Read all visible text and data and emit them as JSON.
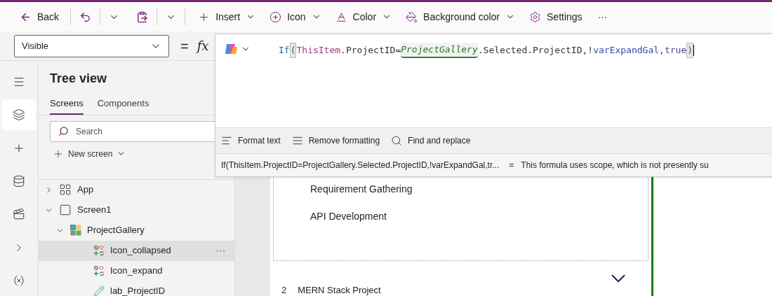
{
  "toolbar": {
    "back": "Back",
    "items": [
      {
        "label": "Insert"
      },
      {
        "label": "Icon"
      },
      {
        "label": "Color"
      },
      {
        "label": "Background color"
      }
    ],
    "settings": "Settings",
    "more": "···"
  },
  "formula_bar": {
    "property": "Visible",
    "equals": "=",
    "fx": "fx",
    "tokens": [
      {
        "kind": "function",
        "text": "If"
      },
      {
        "kind": "paren",
        "text": "("
      },
      {
        "kind": "object",
        "text": "ThisItem"
      },
      {
        "kind": "plain",
        "text": ".ProjectID="
      },
      {
        "kind": "control",
        "text": "ProjectGallery",
        "highlighted": true
      },
      {
        "kind": "plain",
        "text": ".Selected.ProjectID,!"
      },
      {
        "kind": "variable",
        "text": "varExpandGal"
      },
      {
        "kind": "plain",
        "text": ","
      },
      {
        "kind": "keyword",
        "text": "true"
      },
      {
        "kind": "paren",
        "text": ")"
      }
    ],
    "actions": [
      "Format text",
      "Remove formatting",
      "Find and replace"
    ],
    "result": {
      "expression": "If(ThisItem.ProjectID=ProjectGallery.Selected.ProjectID,!varExpandGal,tr...",
      "equals": "=",
      "message": "This formula uses scope, which is not presently su"
    }
  },
  "rail": [
    {
      "selected": false
    },
    {
      "selected": true
    },
    {
      "selected": false
    },
    {
      "selected": false
    },
    {
      "selected": false
    },
    {
      "selected": false
    },
    {
      "selected": false
    }
  ],
  "tree_view": {
    "title": "Tree view",
    "tabs": [
      {
        "label": "Screens",
        "selected": true
      },
      {
        "label": "Components",
        "selected": false
      }
    ],
    "search": {
      "placeholder": "Search"
    },
    "new_screen": "New screen",
    "items": [
      {
        "kind": "app",
        "label": "App",
        "expanded": false,
        "selected": false
      },
      {
        "kind": "screen",
        "label": "Screen1",
        "expanded": true,
        "selected": false,
        "children": [
          {
            "kind": "gallery",
            "label": "ProjectGallery",
            "expanded": true,
            "selected": false,
            "children": [
              {
                "kind": "icon",
                "label": "Icon_collapsed",
                "selected": true,
                "more": "···"
              },
              {
                "kind": "icon",
                "label": "Icon_expand",
                "selected": false
              },
              {
                "kind": "label",
                "label": "lab_ProjectID",
                "selected": false
              }
            ]
          }
        ]
      }
    ]
  },
  "canvas": {
    "tasks": [
      "Requirement Gathering",
      "API Development"
    ],
    "next_item": {
      "number": "2",
      "title": "MERN Stack Project"
    }
  }
}
